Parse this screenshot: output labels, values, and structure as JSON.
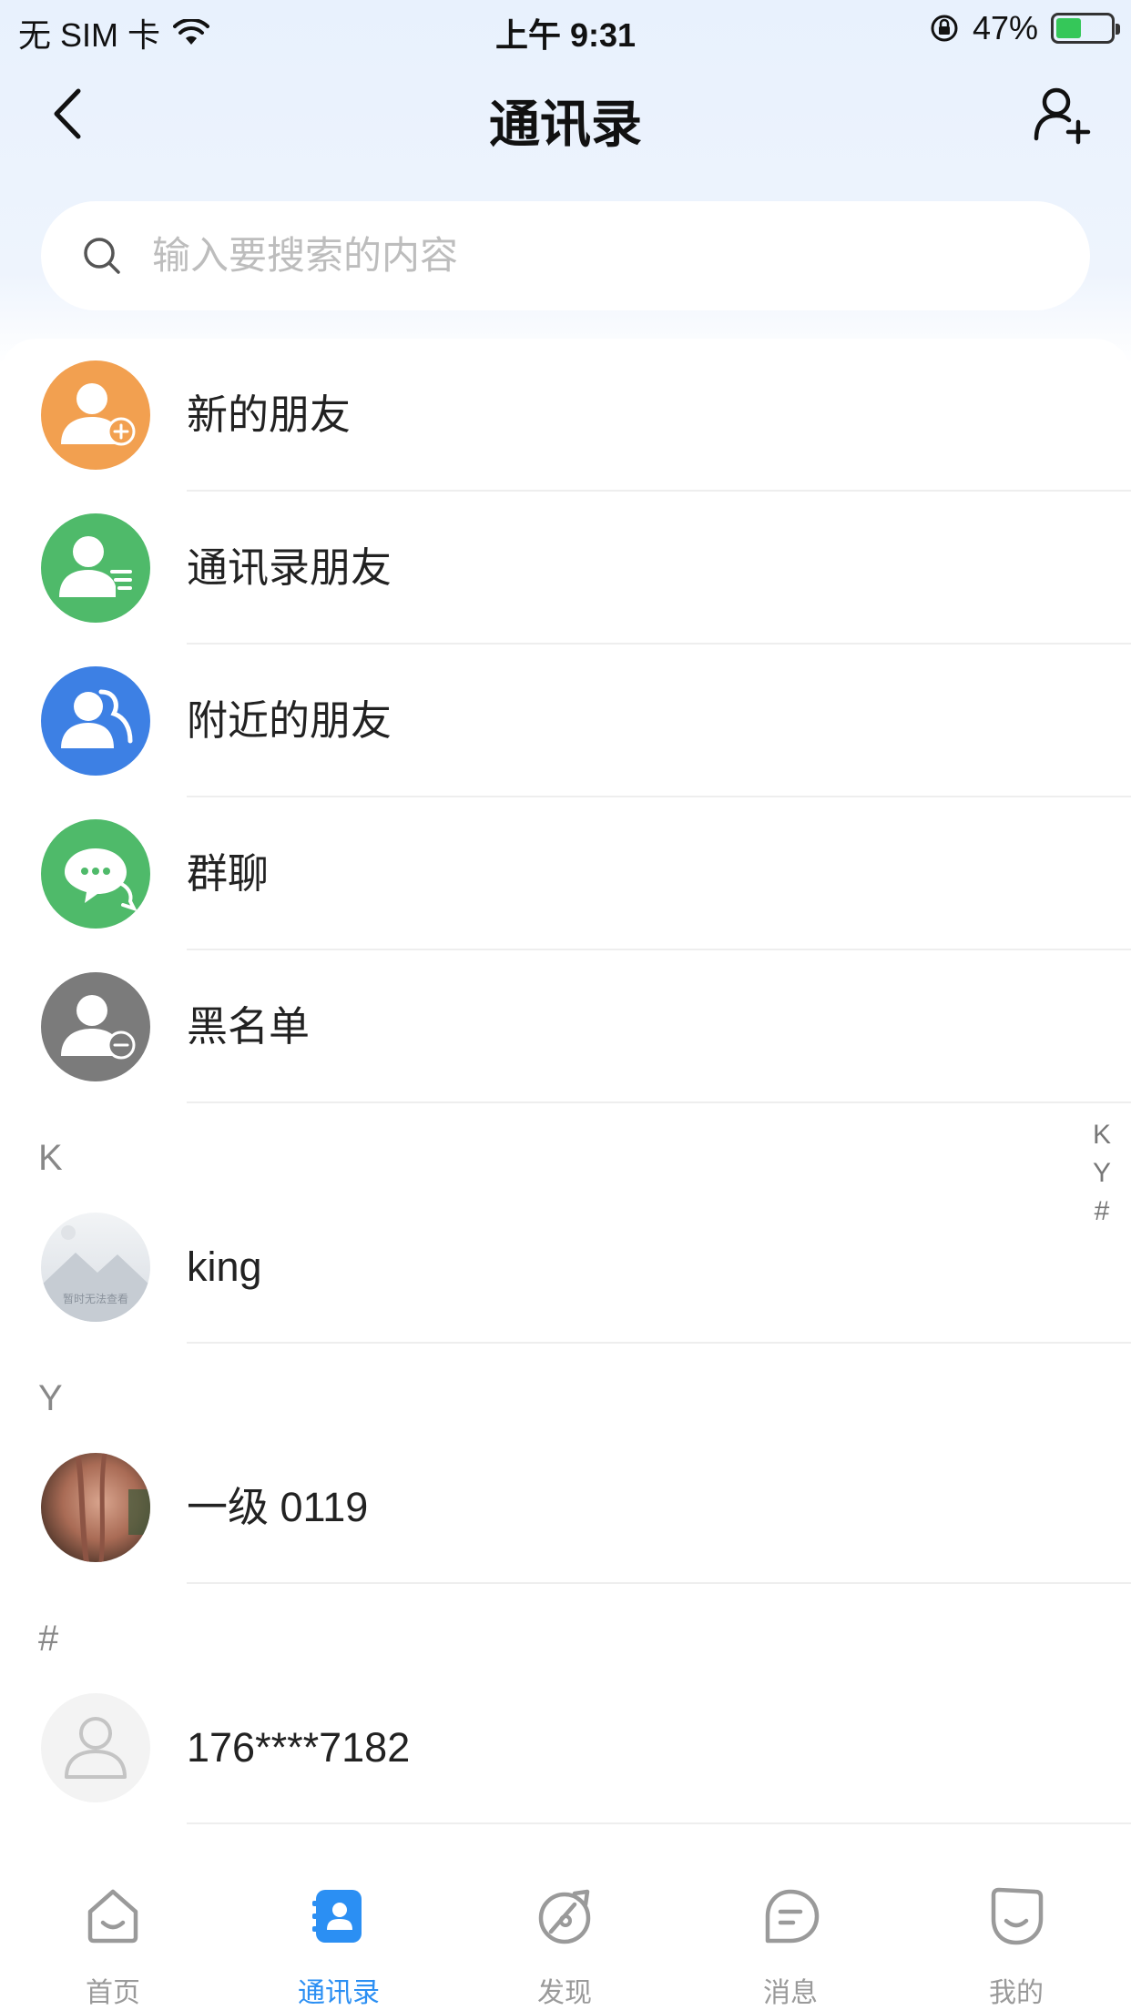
{
  "status_bar": {
    "carrier": "无 SIM 卡",
    "time": "上午 9:31",
    "battery": "47%",
    "battery_level": 0.47
  },
  "nav": {
    "title": "通讯录",
    "back_icon": "chevron-left-icon",
    "add_icon": "add-user-icon"
  },
  "search": {
    "placeholder": "输入要搜索的内容",
    "value": ""
  },
  "menu": [
    {
      "label": "新的朋友",
      "icon": "new-friend-icon",
      "color": "#f2a050"
    },
    {
      "label": "通讯录朋友",
      "icon": "contacts-friend-icon",
      "color": "#4fba6a"
    },
    {
      "label": "附近的朋友",
      "icon": "nearby-friends-icon",
      "color": "#3d80e4"
    },
    {
      "label": "群聊",
      "icon": "group-chat-icon",
      "color": "#4fba6a"
    },
    {
      "label": "黑名单",
      "icon": "blacklist-icon",
      "color": "#7b7b7b"
    }
  ],
  "sections": [
    {
      "letter": "K",
      "contacts": [
        {
          "name": "king",
          "avatar_text": "暂时无法查看"
        }
      ]
    },
    {
      "letter": "Y",
      "contacts": [
        {
          "name": "一级 0119"
        }
      ]
    },
    {
      "letter": "#",
      "contacts": [
        {
          "name": "176****7182"
        }
      ]
    }
  ],
  "index_bar": [
    "K",
    "Y",
    "#"
  ],
  "tabs": [
    {
      "label": "首页",
      "icon": "home-icon",
      "active": false
    },
    {
      "label": "通讯录",
      "icon": "contacts-icon",
      "active": true
    },
    {
      "label": "发现",
      "icon": "discover-icon",
      "active": false
    },
    {
      "label": "消息",
      "icon": "message-icon",
      "active": false
    },
    {
      "label": "我的",
      "icon": "profile-icon",
      "active": false
    }
  ],
  "colors": {
    "accent": "#2b8ff3",
    "inactive_tab": "#9a9a9a"
  }
}
